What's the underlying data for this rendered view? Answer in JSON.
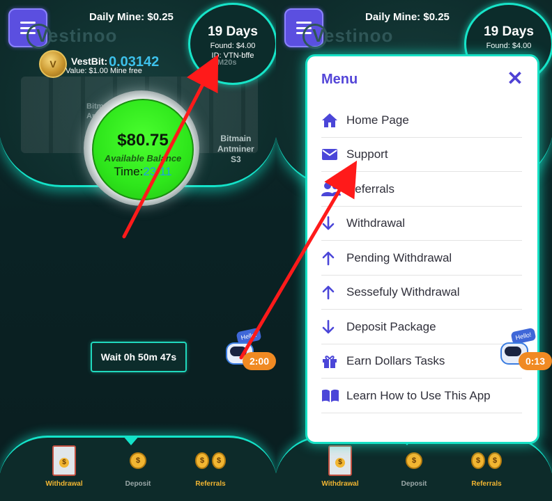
{
  "left_screen": {
    "daily_mine": "Daily Mine: $0.25",
    "brand": "Vestinoo",
    "days_badge": {
      "days": "19 Days",
      "found": "Found: $4.00",
      "id": "ID: VTN-bffe"
    },
    "vestbit": {
      "label": "VestBit:",
      "value": "0.03142",
      "subline": "Value: $1.00 Mine free"
    },
    "machine_left": "Bitm\nAn",
    "machine_right": "Bitmain\nAntminer\nS3",
    "m20s": "M20s",
    "balance": {
      "amount": "$80.75",
      "label": "Available Balance",
      "time_label": "Time:",
      "time_value": "23:11"
    },
    "wait": "Wait 0h 50m 47s",
    "bot": {
      "hello": "Hello!",
      "timer": "2:00"
    },
    "nav": [
      {
        "label": "Withdrawal",
        "color": "#f0b532"
      },
      {
        "label": "Deposit",
        "color": "#9aa8a8"
      },
      {
        "label": "Referrals",
        "color": "#f0b532"
      }
    ]
  },
  "right_screen": {
    "daily_mine": "Daily Mine: $0.25",
    "brand": "Vestinoo",
    "days_badge": {
      "days": "19 Days",
      "found": "Found: $4.00"
    },
    "menu": {
      "title": "Menu",
      "close_icon": "close-icon",
      "items": [
        {
          "label": "Home Page",
          "icon": "home-icon"
        },
        {
          "label": "Support",
          "icon": "mail-icon"
        },
        {
          "label": "Referrals",
          "icon": "users-icon"
        },
        {
          "label": "Withdrawal",
          "icon": "arrow-down-icon"
        },
        {
          "label": "Pending Withdrawal",
          "icon": "arrow-up-icon"
        },
        {
          "label": "Sessefuly Withdrawal",
          "icon": "arrow-up-icon"
        },
        {
          "label": "Deposit Package",
          "icon": "arrow-down-icon"
        },
        {
          "label": "Earn Dollars Tasks",
          "icon": "gift-icon"
        },
        {
          "label": "Learn How to Use This App",
          "icon": "book-icon"
        }
      ]
    },
    "bot": {
      "hello": "Hello!",
      "timer": "0:13"
    },
    "nav": [
      {
        "label": "Withdrawal",
        "color": "#f0b532"
      },
      {
        "label": "Deposit",
        "color": "#9aa8a8"
      },
      {
        "label": "Referrals",
        "color": "#f0b532"
      }
    ]
  },
  "colors": {
    "accent": "#14e3c9",
    "menu_purple": "#5446d8",
    "balance_green": "#2ee61b",
    "arrow_red": "#ff1a1a"
  }
}
